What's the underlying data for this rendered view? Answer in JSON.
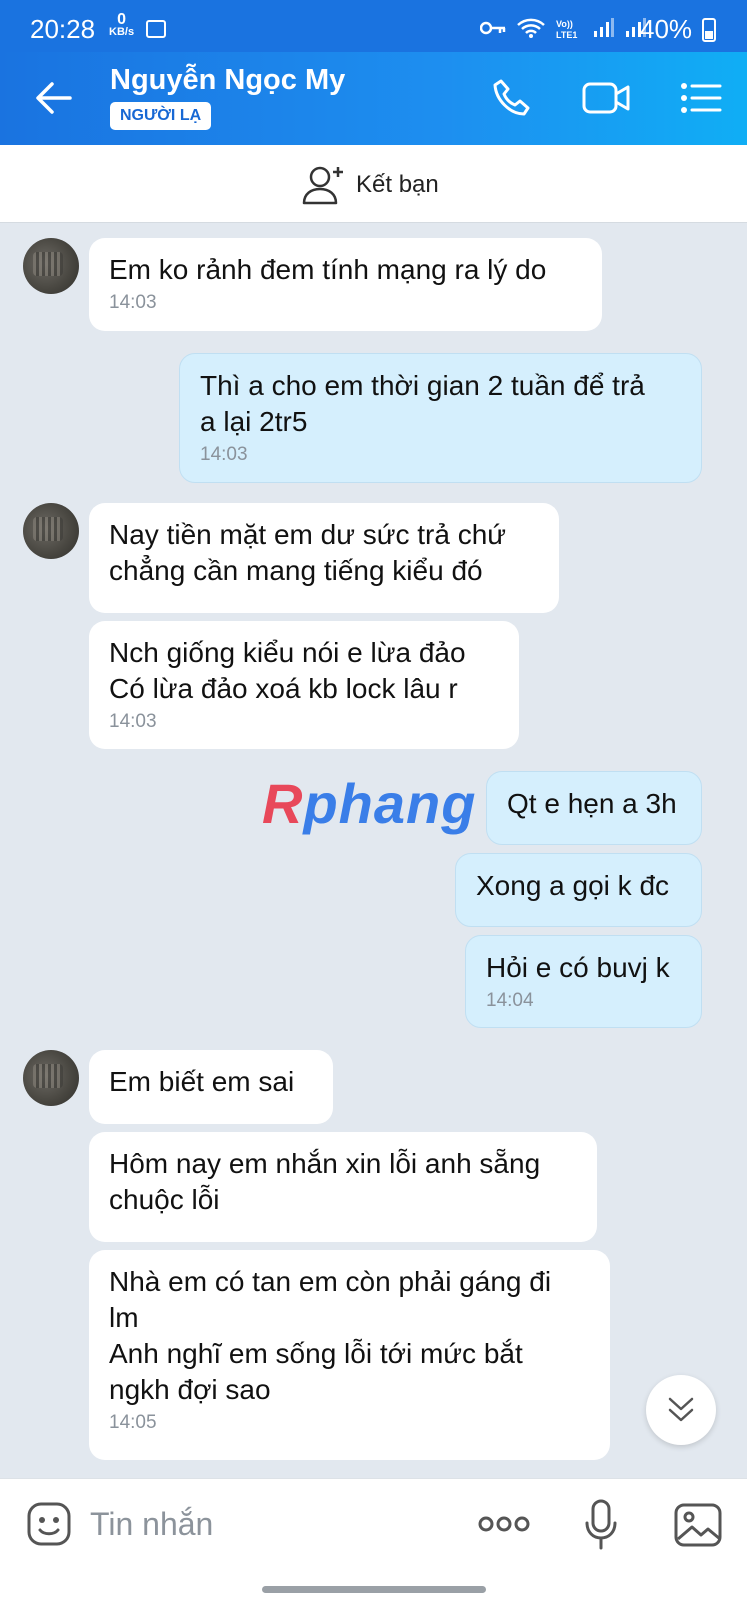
{
  "status_bar": {
    "time": "20:28",
    "net_speed_value": "0",
    "net_speed_unit": "KB/s",
    "battery": "40%"
  },
  "header": {
    "contact_name": "Nguyễn Ngọc My",
    "badge": "NGƯỜI LẠ"
  },
  "friend_bar": {
    "label": "Kết bạn"
  },
  "messages": [
    {
      "side": "received",
      "text": "Em ko rảnh đem tính mạng ra lý do",
      "time": "14:03"
    },
    {
      "side": "sent",
      "text": "Thì a cho em thời gian 2 tuần để trả\na lại 2tr5",
      "time": "14:03"
    },
    {
      "side": "received",
      "text": "Nay tiền mặt em dư sức trả chứ\nchẳng cần mang tiếng kiểu đó",
      "time": ""
    },
    {
      "side": "received",
      "text": "Nch giống kiểu nói e lừa đảo\nCó lừa đảo xoá kb lock lâu r",
      "time": "14:03"
    },
    {
      "side": "sent",
      "text": "Qt e hẹn a 3h",
      "time": ""
    },
    {
      "side": "sent",
      "text": "Xong a gọi k đc",
      "time": ""
    },
    {
      "side": "sent",
      "text": "Hỏi e có buvj k",
      "time": "14:04"
    },
    {
      "side": "received",
      "text": "Em biết em sai",
      "time": ""
    },
    {
      "side": "received",
      "text": "Hôm nay em nhắn xin lỗi anh sẵng\nchuộc lỗi",
      "time": ""
    },
    {
      "side": "received",
      "text": "Nhà em có tan em còn phải gáng đi\nlm\nAnh nghĩ em sống lỗi tới mức bắt\nngkh đợi sao",
      "time": "14:05"
    }
  ],
  "watermark": {
    "first_letter": "R",
    "rest": "phang"
  },
  "input_bar": {
    "placeholder": "Tin nhắn"
  },
  "icons": {
    "back": "arrow-left-icon",
    "call": "phone-icon",
    "video": "video-camera-icon",
    "menu": "list-menu-icon",
    "add_friend": "person-add-icon",
    "scroll_down": "double-chevron-down-icon",
    "emoji": "sticker-icon",
    "more": "more-dots-icon",
    "mic": "microphone-icon",
    "gallery": "image-icon"
  },
  "colors": {
    "header_start": "#1a73e0",
    "header_end": "#10aef5",
    "chat_background": "#e2e8ef",
    "sent_bubble": "#d5effd",
    "received_bubble": "#ffffff"
  }
}
